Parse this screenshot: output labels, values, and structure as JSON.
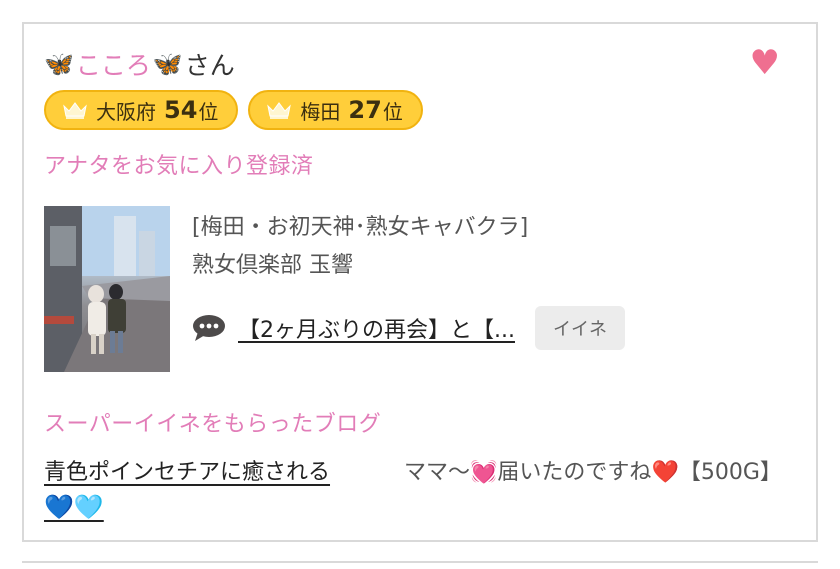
{
  "user": {
    "emoji_left": "🦋",
    "nickname": "こころ",
    "emoji_right": "🦋",
    "suffix": "さん"
  },
  "favorite_icon": "heart-icon",
  "badges": [
    {
      "area": "大阪府",
      "rank": "54",
      "unit": "位",
      "icon": "crown-icon"
    },
    {
      "area": "梅田",
      "rank": "27",
      "unit": "位",
      "icon": "crown-icon"
    }
  ],
  "favorite_status": "アナタをお気に入り登録済",
  "shop": {
    "category": "[梅田・お初天神･熟女キャバクラ]",
    "name": "熟女倶楽部 玉響"
  },
  "blog": {
    "icon": "speech-bubble-icon",
    "title": "【2ヶ月ぶりの再会】と【...",
    "like_label": "イイネ"
  },
  "super_like": {
    "heading": "スーパーイイネをもらったブログ",
    "blog_title": "青色ポインセチアに癒される",
    "blog_title_hearts": "💙🩵",
    "comment_part1": "ママ〜",
    "comment_emoji1": "💓",
    "comment_part2": "届いたのですね",
    "comment_emoji2": "❤️",
    "comment_part3": "【500G】"
  },
  "colors": {
    "accent_pink": "#e27db8",
    "heart_pink": "#ef6f90",
    "badge_yellow": "#ffce3a",
    "border_gray": "#d9d9d9"
  }
}
